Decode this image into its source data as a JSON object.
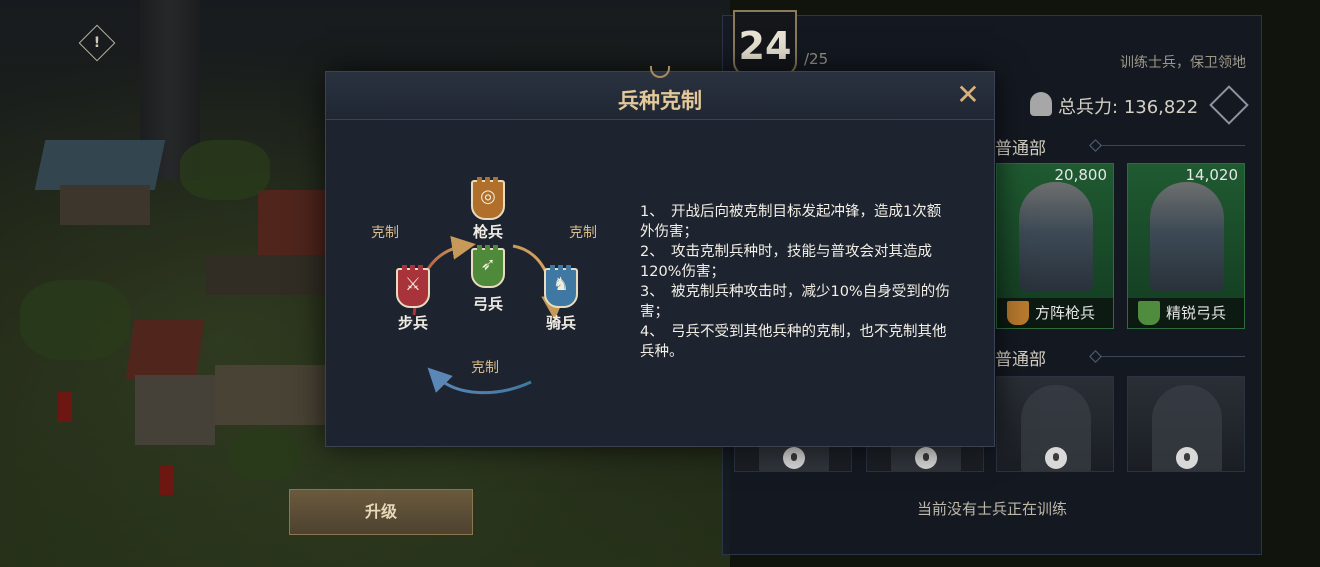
{
  "header": {
    "level": "24",
    "level_max": "/25",
    "motto": "训练士兵，保卫领地",
    "total_power_label": "总兵力:",
    "total_power_value": "136,822"
  },
  "sections": [
    {
      "title": "普通部"
    },
    {
      "title": "普通部"
    }
  ],
  "cards": [
    {
      "count": "20,800",
      "name": "方阵枪兵",
      "icon": "spearman-icon",
      "icon_color": "#b87a2e"
    },
    {
      "count": "14,020",
      "name": "精锐弓兵",
      "icon": "archer-icon",
      "icon_color": "#4f8c3e"
    }
  ],
  "locked_slots": 4,
  "idle_text": "当前没有士兵正在训练",
  "upgrade_label": "升级",
  "modal": {
    "title": "兵种克制",
    "close_icon": "close-icon",
    "units": {
      "spear": {
        "label": "枪兵",
        "color": "#b0702c",
        "icon": "spear-shield-icon"
      },
      "bow": {
        "label": "弓兵",
        "color": "#4e8a3a",
        "icon": "bow-shield-icon"
      },
      "cavalry": {
        "label": "骑兵",
        "color": "#3f78a2",
        "icon": "horse-shield-icon"
      },
      "infantry": {
        "label": "步兵",
        "color": "#a8333a",
        "icon": "swords-shield-icon"
      }
    },
    "counter_labels": [
      "克制",
      "克制",
      "克制"
    ],
    "rules": [
      "1、　开战后向被克制目标发起冲锋，造成1次额外伤害；",
      "2、　攻击克制兵种时，技能与普攻会对其造成120%伤害；",
      "3、　被克制兵种攻击时，减少10%自身受到的伤害；",
      "4、　弓兵不受到其他兵种的克制，也不克制其他兵种。"
    ]
  }
}
